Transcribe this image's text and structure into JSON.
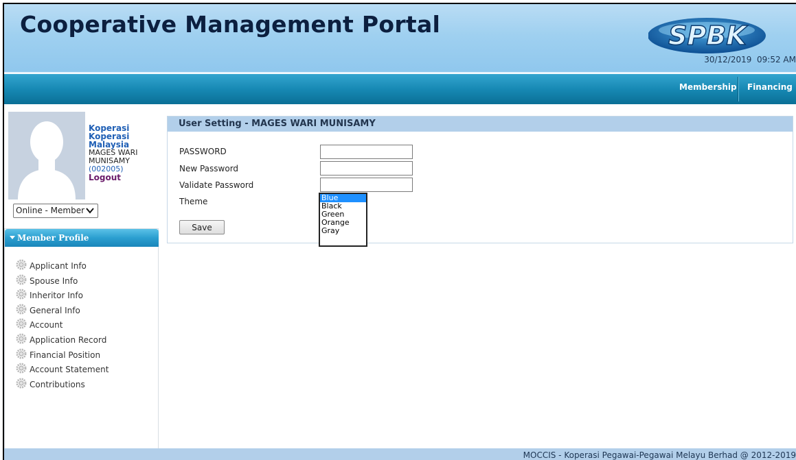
{
  "header": {
    "title": "Cooperative Management Portal",
    "logo_text": "SPBK",
    "date": "30/12/2019",
    "time": "09:52 AM"
  },
  "nav": {
    "membership": "Membership",
    "financing": "Financing"
  },
  "user": {
    "org_line1": "Koperasi",
    "org_line2": "Koperasi",
    "org_line3": "Malaysia",
    "name_line1": "MAGES WARI",
    "name_line2": "MUNISAMY",
    "member_id": "(002005)",
    "logout": "Logout",
    "status_selected": "Online - Member"
  },
  "member_profile": {
    "title": "Member Profile",
    "items": [
      {
        "label": "Applicant Info"
      },
      {
        "label": "Spouse Info"
      },
      {
        "label": "Inheritor Info"
      },
      {
        "label": "General Info"
      },
      {
        "label": "Account"
      },
      {
        "label": "Application Record"
      },
      {
        "label": "Financial Position"
      },
      {
        "label": "Account Statement"
      },
      {
        "label": "Contributions"
      }
    ]
  },
  "user_setting": {
    "title": "User Setting - MAGES WARI MUNISAMY",
    "password_label": "PASSWORD",
    "new_password_label": "New Password",
    "validate_password_label": "Validate Password",
    "theme_label": "Theme",
    "save_label": "Save",
    "theme_options": [
      "Blue",
      "Black",
      "Green",
      "Orange",
      "Gray"
    ],
    "theme_selected": "Blue"
  },
  "footer": {
    "text": "MOCCIS - Koperasi Pegawai-Pegawai Melayu Berhad @ 2012-2019"
  },
  "colors": {
    "header_bg": "#9fd0f0",
    "nav_bg": "#1789b4",
    "panel_header": "#b2cfea",
    "accent_blue": "#1f5fb5",
    "logout_purple": "#6a1b6a"
  }
}
